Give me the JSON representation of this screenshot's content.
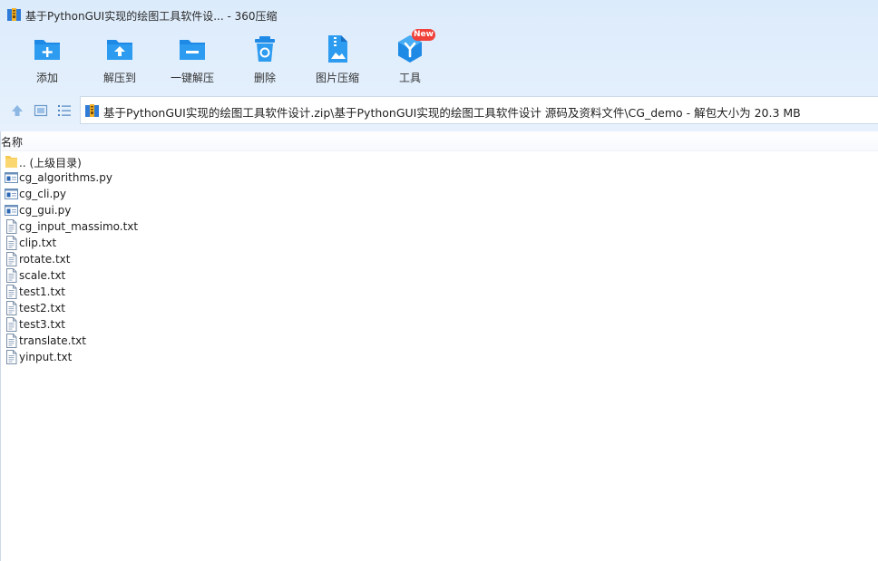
{
  "window": {
    "title": "基于PythonGUI实现的绘图工具软件设... - 360压缩"
  },
  "toolbar": {
    "items": [
      {
        "label": "添加",
        "icon": "add-icon"
      },
      {
        "label": "解压到",
        "icon": "extract-to-icon"
      },
      {
        "label": "一键解压",
        "icon": "one-click-extract-icon"
      },
      {
        "label": "删除",
        "icon": "delete-icon"
      },
      {
        "label": "图片压缩",
        "icon": "image-compress-icon"
      },
      {
        "label": "工具",
        "icon": "tools-icon"
      }
    ],
    "new_badge": "New"
  },
  "nav": {
    "icons": [
      "up-arrow-icon",
      "thumbnail-view-icon",
      "list-view-icon"
    ],
    "address": "基于PythonGUI实现的绘图工具软件设计.zip\\基于PythonGUI实现的绘图工具软件设计 源码及资料文件\\CG_demo - 解包大小为 20.3 MB"
  },
  "list": {
    "column_name": "名称",
    "files": [
      {
        "name": ".. (上级目录)",
        "type": "folder"
      },
      {
        "name": "cg_algorithms.py",
        "type": "py"
      },
      {
        "name": "cg_cli.py",
        "type": "py"
      },
      {
        "name": "cg_gui.py",
        "type": "py"
      },
      {
        "name": "cg_input_massimo.txt",
        "type": "txt"
      },
      {
        "name": "clip.txt",
        "type": "txt"
      },
      {
        "name": "rotate.txt",
        "type": "txt"
      },
      {
        "name": "scale.txt",
        "type": "txt"
      },
      {
        "name": "test1.txt",
        "type": "txt"
      },
      {
        "name": "test2.txt",
        "type": "txt"
      },
      {
        "name": "test3.txt",
        "type": "txt"
      },
      {
        "name": "translate.txt",
        "type": "txt"
      },
      {
        "name": "yinput.txt",
        "type": "txt"
      }
    ]
  },
  "colors": {
    "accent": "#1e8ae6",
    "toolbar_bg": "#dcebfb",
    "badge": "#f0413a"
  }
}
